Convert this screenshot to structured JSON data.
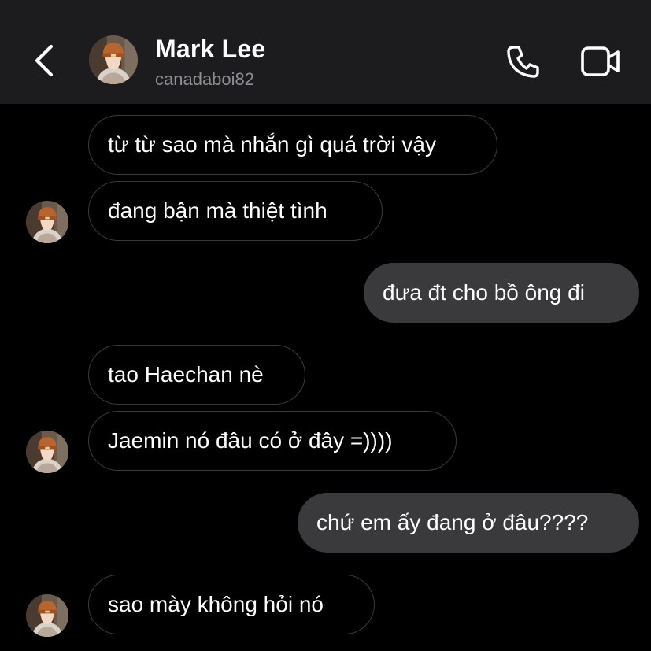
{
  "header": {
    "name": "Mark Lee",
    "username": "canadaboi82",
    "back_icon": "chevron-left-icon",
    "call_icon": "phone-icon",
    "video_icon": "video-camera-icon"
  },
  "messages": [
    {
      "direction": "in",
      "text": "từ từ sao mà nhắn gì quá trời vậy"
    },
    {
      "direction": "in",
      "text": "đang bận mà thiệt tình"
    },
    {
      "direction": "out",
      "text": "đưa đt cho bồ ông đi"
    },
    {
      "direction": "in",
      "text": "tao Haechan nè"
    },
    {
      "direction": "in",
      "text": "Jaemin nó đâu có ở đây =))))"
    },
    {
      "direction": "out",
      "text": "chứ em ấy đang ở đâu????"
    },
    {
      "direction": "in",
      "text": "sao mày không hỏi nó"
    }
  ],
  "colors": {
    "background": "#000000",
    "header_background": "#1c1c1e",
    "incoming_border": "#3a3a3c",
    "outgoing_bubble": "#3a3a3c",
    "secondary_text": "#8e8e93",
    "text": "#ffffff"
  }
}
